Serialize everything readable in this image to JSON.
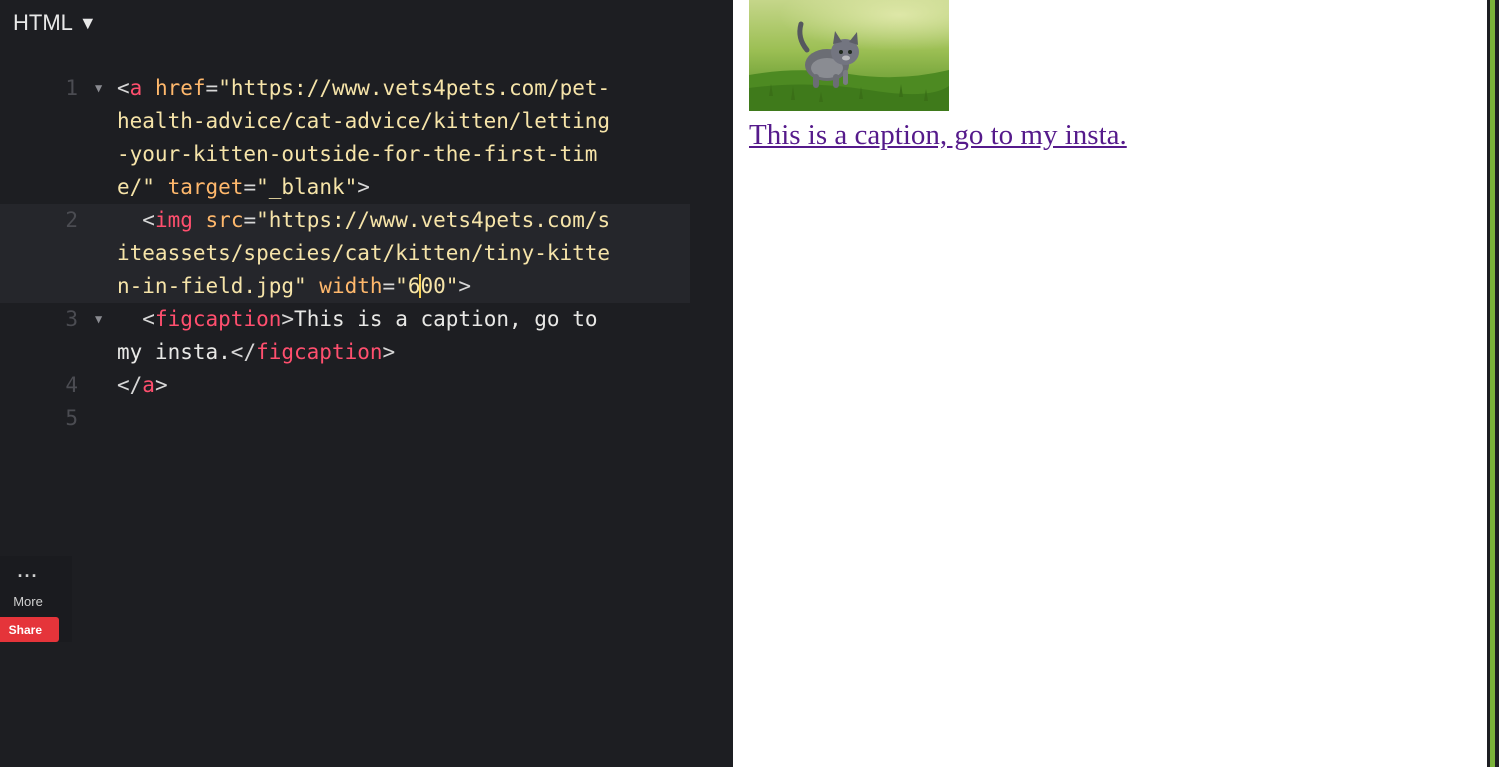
{
  "editor": {
    "panel_label": "HTML",
    "line_numbers": [
      "1",
      "2",
      "3",
      "4",
      "5"
    ],
    "line1": {
      "r1": {
        "lt": "<",
        "tag": "a",
        "attr": " href",
        "eq": "=",
        "q": "\"",
        "val": "https://www.vets4pets.com/pet-"
      },
      "r2": "health-advice/cat-advice/kitten/letting",
      "r3": "-your-kitten-outside-for-the-first-tim",
      "r4": {
        "val": "e/\"",
        "attr": " target",
        "eq": "=",
        "str": "\"_blank\"",
        "gt": ">"
      }
    },
    "line2": {
      "r1": {
        "indent": "  ",
        "lt": "<",
        "tag": "img",
        "attr": " src",
        "eq": "=",
        "val": "\"https://www.vets4pets.com/s"
      },
      "r2": "iteassets/species/cat/kitten/tiny-kitte",
      "r3": {
        "val": "n-in-field.jpg\"",
        "attr": " width",
        "eq": "=",
        "str_a": "\"6",
        "str_b": "00\"",
        "gt": ">"
      }
    },
    "line3": {
      "r1": {
        "indent": "  ",
        "lt": "<",
        "tag": "figcaption",
        "gt": ">",
        "text": "This is a caption, go to"
      },
      "r2": {
        "text": "my insta.",
        "lt": "</",
        "tag": "figcaption",
        "gt": ">"
      }
    },
    "line4": {
      "lt": "</",
      "tag": "a",
      "gt": ">"
    }
  },
  "sidebar": {
    "more_icon": "···",
    "more_label": "More",
    "share_label": "Share"
  },
  "preview": {
    "image_icon": "kitten-in-field-image",
    "caption_link": "This is a caption, go to my insta."
  },
  "colors": {
    "editor_bg": "#1d1e22",
    "tag": "#ff4f6e",
    "attr": "#ffb86c",
    "string": "#f6e4a9",
    "link": "#551a8b",
    "share": "#e5343a",
    "accent": "#7bb33a"
  }
}
